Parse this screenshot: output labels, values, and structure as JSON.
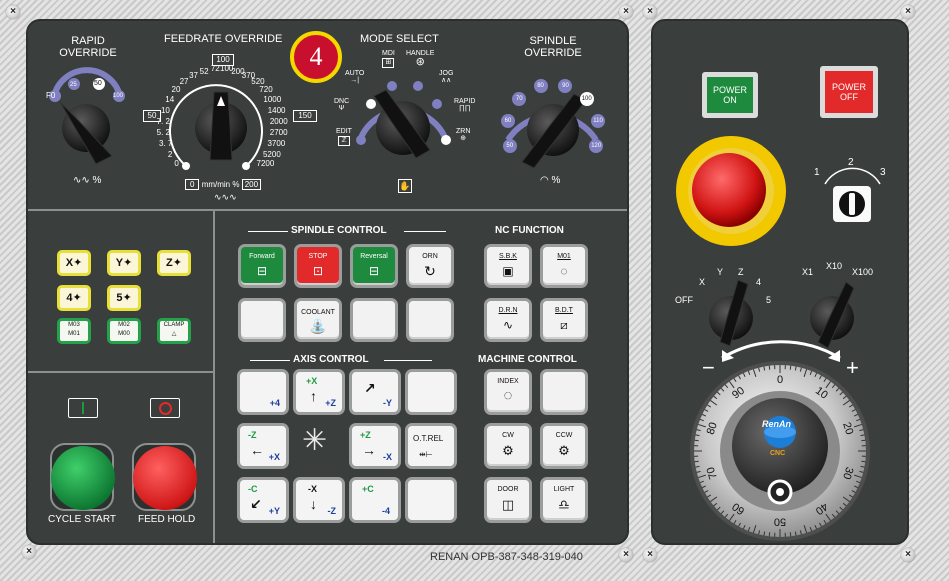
{
  "badge": {
    "number": "4"
  },
  "footer": {
    "brand_code": "RENAN OPB-387-348-319-040"
  },
  "rapid": {
    "title_line1": "RAPID",
    "title_line2": "OVERRIDE",
    "marks": [
      "F0",
      "25",
      "50",
      "100"
    ],
    "unit": "%"
  },
  "feed": {
    "title": "FEEDRATE OVERRIDE",
    "top_value": "100",
    "left_value": "50",
    "right_value": "150",
    "scale": [
      "0",
      "2",
      "3. 7",
      "5. 2",
      "7. 2",
      "10",
      "14",
      "20",
      "27",
      "37",
      "52",
      "72",
      "100",
      "200",
      "370",
      "520",
      "720",
      "1000",
      "1400",
      "2000",
      "2700",
      "3700",
      "5200",
      "7200"
    ],
    "unit_left": "0",
    "unit_text": "mm/min %",
    "unit_right": "200"
  },
  "mode": {
    "title": "MODE SELECT",
    "labels": [
      "AUTO",
      "MDI",
      "HANDLE",
      "JOG",
      "RAPID",
      "ZRN",
      "DNC",
      "EDIT"
    ]
  },
  "spindle_override": {
    "title_line1": "SPINDLE",
    "title_line2": "OVERRIDE",
    "marks": [
      "50",
      "60",
      "70",
      "80",
      "90",
      "100",
      "110",
      "120"
    ],
    "unit": "%"
  },
  "axis_select": {
    "keys": [
      "X",
      "Y",
      "Z",
      "4",
      "5"
    ],
    "m_keys": [
      {
        "top": "M03",
        "bottom": "M01"
      },
      {
        "top": "M02",
        "bottom": "M00"
      },
      {
        "top": "CLAMP",
        "bottom": ""
      }
    ]
  },
  "cycle": {
    "start_label": "CYCLE START",
    "hold_label": "FEED HOLD"
  },
  "spindle_control": {
    "title": "SPINDLE CONTROL",
    "row1": [
      "Forward",
      "STOP",
      "Reversal",
      "ORN"
    ],
    "coolant": "COOLANT"
  },
  "nc_function": {
    "title": "NC FUNCTION",
    "keys": [
      "S.B.K",
      "M01",
      "D.R.N",
      "B.D.T"
    ]
  },
  "axis_control": {
    "title": "AXIS CONTROL",
    "keys": [
      {
        "top": "",
        "bottom": "+4"
      },
      {
        "top": "+X",
        "bottom": "+Z"
      },
      {
        "top": "",
        "bottom": "-Y"
      },
      {
        "top": "-Z",
        "bottom": "+X"
      },
      {
        "top": "+Z",
        "bottom": "-X"
      },
      {
        "top": "-C",
        "bottom": "+Y"
      },
      {
        "top": "-X",
        "bottom": "-Z"
      },
      {
        "top": "+C",
        "bottom": "-4"
      }
    ],
    "otrel": "O.T.REL"
  },
  "machine_control": {
    "title": "MACHINE CONTROL",
    "keys": [
      "INDEX",
      "CW",
      "CCW",
      "DOOR",
      "LIGHT"
    ]
  },
  "power": {
    "on_line1": "POWER",
    "on_line2": "ON",
    "off_line1": "POWER",
    "off_line2": "OFF"
  },
  "key_switch": {
    "marks": [
      "1",
      "2",
      "3"
    ]
  },
  "axis_knob": {
    "marks": [
      "OFF",
      "X",
      "Y",
      "Z",
      "4",
      "5"
    ]
  },
  "step_knob": {
    "marks": [
      "X1",
      "X10",
      "X100"
    ]
  },
  "handwheel": {
    "minus": "−",
    "plus": "+",
    "logo": "RenAn",
    "sub": "CNC",
    "marks": [
      "0",
      "10",
      "20",
      "30",
      "40",
      "50",
      "60",
      "70",
      "80",
      "90"
    ]
  },
  "colors": {
    "plate": "#3a3f3d",
    "badge": "#c8102e",
    "badge_ring": "#f5d800",
    "power_on": "#1d8a3e",
    "power_off": "#e22a2a",
    "estop_ring": "#f2c800"
  }
}
